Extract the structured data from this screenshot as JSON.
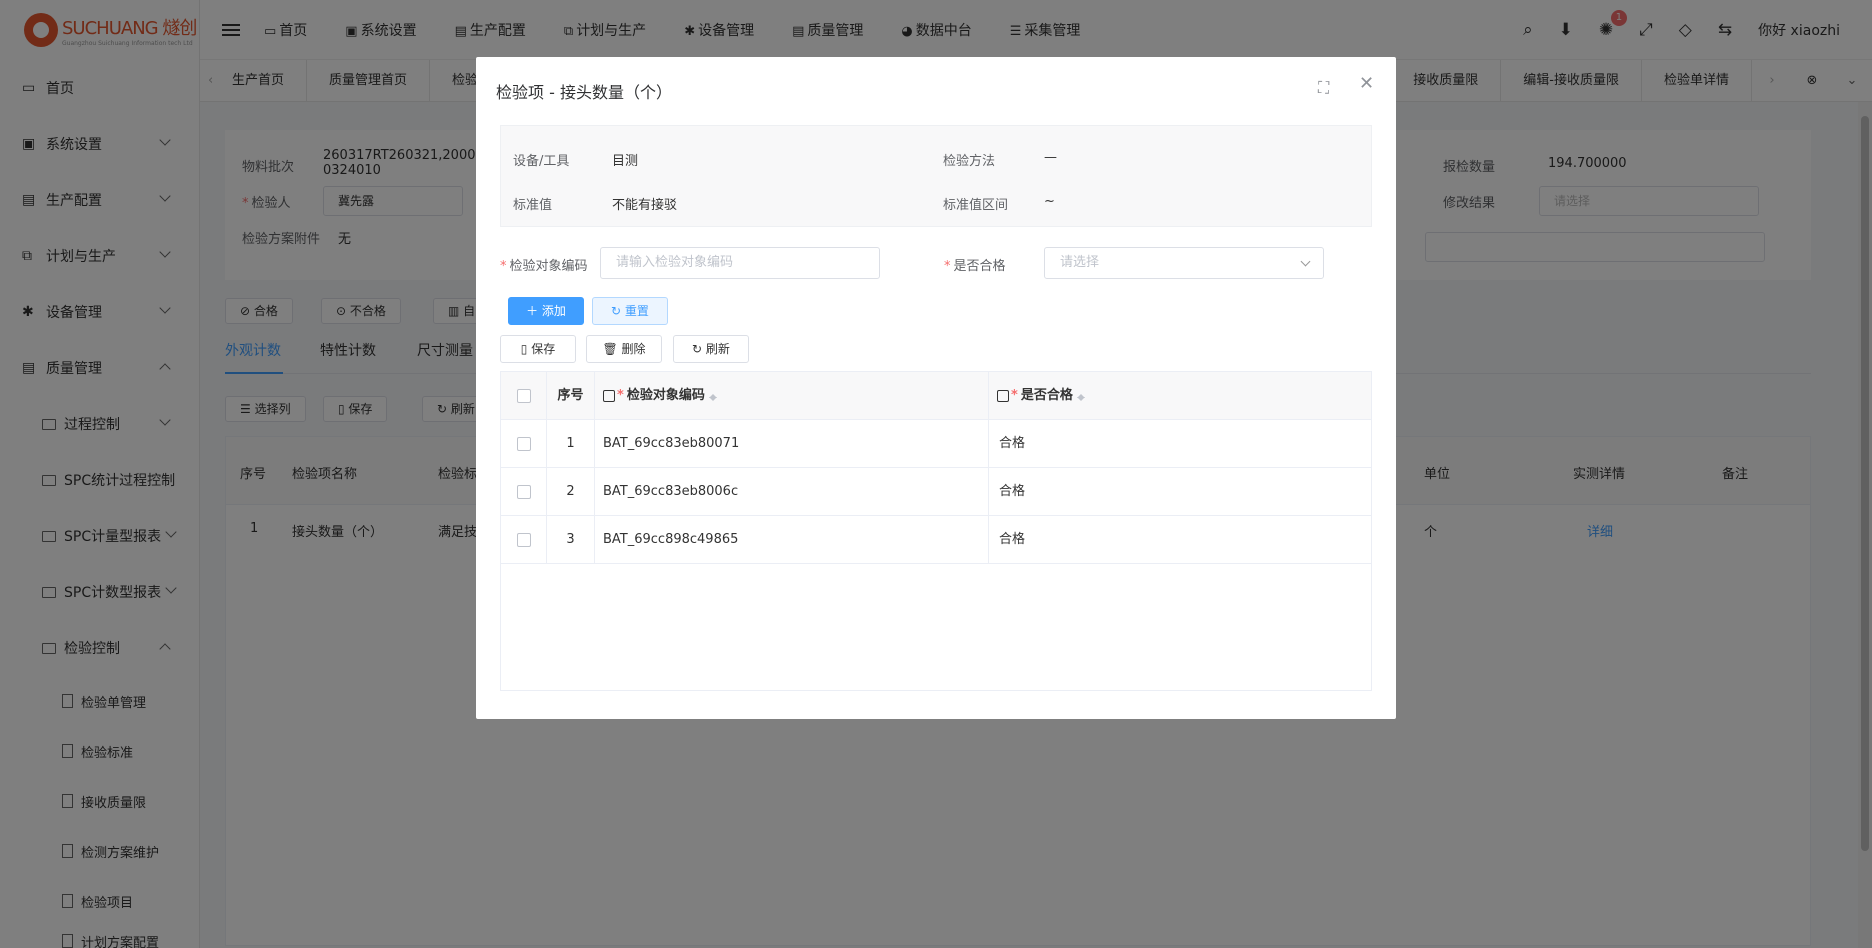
{
  "logo": {
    "brand": "SUCHUANG 燧创",
    "sub": "Guangzhou Suichuang Information tech Ltd"
  },
  "sidebar": {
    "items": [
      {
        "label": "首页"
      },
      {
        "label": "系统设置"
      },
      {
        "label": "生产配置"
      },
      {
        "label": "计划与生产"
      },
      {
        "label": "设备管理"
      },
      {
        "label": "质量管理"
      }
    ],
    "sub": [
      "过程控制",
      "SPC统计过程控制",
      "SPC计量型报表",
      "SPC计数型报表",
      "检验控制"
    ],
    "sub2": [
      "检验单管理",
      "检验标准",
      "接收质量限",
      "检测方案维护",
      "检验项目",
      "计划方案配置"
    ]
  },
  "topnav": [
    "首页",
    "系统设置",
    "生产配置",
    "计划与生产",
    "设备管理",
    "质量管理",
    "数据中台",
    "采集管理"
  ],
  "header": {
    "badge": "1",
    "user": "你好 xiaozhi"
  },
  "tabs": [
    "生产首页",
    "质量管理首页",
    "检验",
    "接收质量限",
    "编辑-接收质量限",
    "检验单详情"
  ],
  "form": {
    "batch_label": "物料批次",
    "batch_value": "260317RT260321,2000-0324010",
    "inspector_label": "检验人",
    "inspector_value": "冀先露",
    "attach_label": "检验方案附件",
    "attach_value": "无",
    "qty_label": "报检数量",
    "qty_value": "194.700000",
    "result_label": "修改结果",
    "result_placeholder": "请选择"
  },
  "actions": [
    "合格",
    "不合格",
    "自"
  ],
  "subtabs": [
    "外观计数",
    "特性计数",
    "尺寸测量"
  ],
  "listtools": [
    "选择列",
    "保存",
    "刷新"
  ],
  "bgtable": {
    "headers": [
      "序号",
      "检验项名称",
      "检验标",
      "单位",
      "实测详情",
      "备注"
    ],
    "row": [
      "1",
      "接头数量（个）",
      "满足技",
      "个",
      "详细"
    ]
  },
  "dialog": {
    "title": "检验项 - 接头数量（个）",
    "tool_label": "设备/工具",
    "tool_value": "目测",
    "method_label": "检验方法",
    "method_value": "—",
    "std_label": "标准值",
    "std_value": "不能有接驳",
    "range_label": "标准值区间",
    "range_value": "~",
    "code_label": "检验对象编码",
    "code_placeholder": "请输入检验对象编码",
    "pass_label": "是否合格",
    "pass_placeholder": "请选择",
    "add_label": "添加",
    "reset_label": "重置",
    "save_label": "保存",
    "delete_label": "删除",
    "refresh_label": "刷新",
    "columns": [
      "序号",
      "检验对象编码",
      "是否合格"
    ],
    "rows": [
      {
        "no": "1",
        "code": "BAT_69cc83eb80071",
        "pass": "合格"
      },
      {
        "no": "2",
        "code": "BAT_69cc83eb8006c",
        "pass": "合格"
      },
      {
        "no": "3",
        "code": "BAT_69cc898c49865",
        "pass": "合格"
      }
    ]
  },
  "colors": {
    "primary": "#409eff",
    "danger": "#f56c6c",
    "mask": "rgba(0,0,0,0.5)"
  }
}
